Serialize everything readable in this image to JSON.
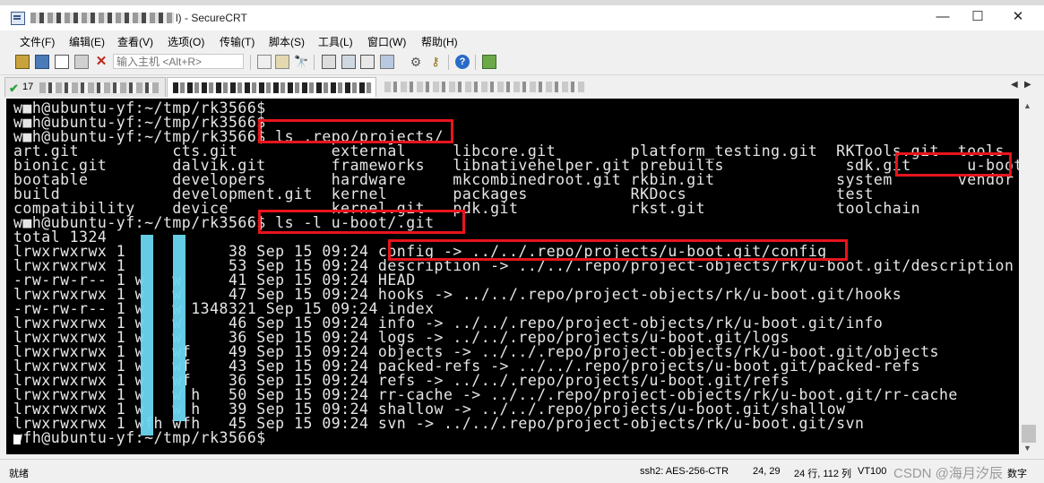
{
  "window": {
    "title_suffix": "l) - SecureCRT",
    "controls": {
      "minimize": "—",
      "maximize": "☐",
      "close": "✕"
    }
  },
  "menu": [
    "文件(F)",
    "编辑(E)",
    "查看(V)",
    "选项(O)",
    "传输(T)",
    "脚本(S)",
    "工具(L)",
    "窗口(W)",
    "帮助(H)"
  ],
  "toolbar": {
    "host_placeholder": "输入主机 <Alt+R>"
  },
  "tabs": {
    "first_tab_number": "17"
  },
  "terminal": {
    "lines": [
      "w■h@ubuntu-yf:~/tmp/rk3566$",
      "w■h@ubuntu-yf:~/tmp/rk3566$",
      "w■h@ubuntu-yf:~/tmp/rk3566$ ls .repo/projects/",
      "art.git          cts.git          external     libcore.git        platform_testing.git  RKTools.git  tools",
      "bionic.git       dalvik.git       frameworks   libnativehelper.git prebuilts             sdk.git      u-boot.git",
      "bootable         developers       hardware     mkcombinedroot.git rkbin.git             system       vendor",
      "build            development.git  kernel       packages           RKDocs                test",
      "compatibility    device           kernel.git   pdk.git            rkst.git              toolchain",
      "w■h@ubuntu-yf:~/tmp/rk3566$ ls -l u-boot/.git",
      "total 1324",
      "lrwxrwxrwx 1           38 Sep 15 09:24 config -> ../../.repo/projects/u-boot.git/config",
      "lrwxrwxrwx 1           53 Sep 15 09:24 description -> ../../.repo/project-objects/rk/u-boot.git/description",
      "-rw-rw-r-- 1 w   w     41 Sep 15 09:24 HEAD",
      "lrwxrwxrwx 1 w   w     47 Sep 15 09:24 hooks -> ../../.repo/project-objects/rk/u-boot.git/hooks",
      "-rw-rw-r-- 1 w   w 1348321 Sep 15 09:24 index",
      "lrwxrwxrwx 1 w   w     46 Sep 15 09:24 info -> ../../.repo/project-objects/rk/u-boot.git/info",
      "lrwxrwxrwx 1 w   w     36 Sep 15 09:24 logs -> ../../.repo/projects/u-boot.git/logs",
      "lrwxrwxrwx 1 w   wf    49 Sep 15 09:24 objects -> ../../.repo/project-objects/rk/u-boot.git/objects",
      "lrwxrwxrwx 1 w   wf    43 Sep 15 09:24 packed-refs -> ../../.repo/projects/u-boot.git/packed-refs",
      "lrwxrwxrwx 1 w   wf    36 Sep 15 09:24 refs -> ../../.repo/projects/u-boot.git/refs",
      "lrwxrwxrwx 1 w   w h   50 Sep 15 09:24 rr-cache -> ../../.repo/project-objects/rk/u-boot.git/rr-cache",
      "lrwxrwxrwx 1 w   w h   39 Sep 15 09:24 shallow -> ../../.repo/projects/u-boot.git/shallow",
      "lrwxrwxrwx 1 wfh wfh   45 Sep 15 09:24 svn -> ../../.repo/project-objects/rk/u-boot.git/svn",
      "wfh@ubuntu-yf:~/tmp/rk3566$"
    ]
  },
  "status": {
    "ready": "就绪",
    "ssh": "ssh2: AES-256-CTR",
    "cursor_pos": "24,  29",
    "size": "24 行, 112 列",
    "emulation": "VT100",
    "watermark": "CSDN @海月汐辰",
    "numlock": "数字"
  }
}
